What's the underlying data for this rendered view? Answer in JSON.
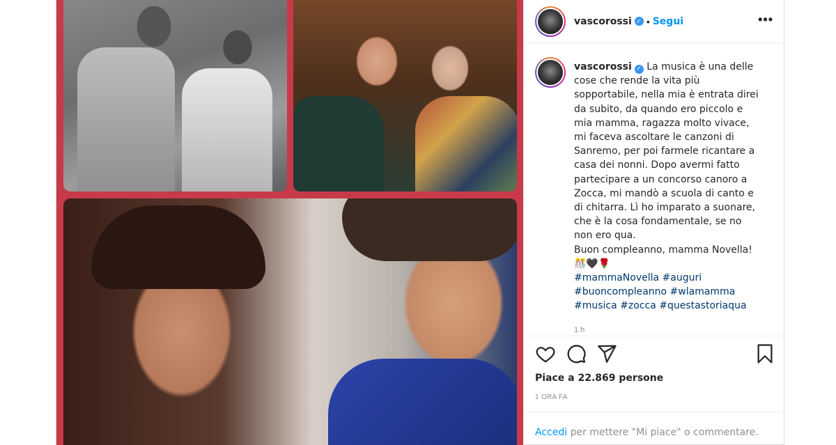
{
  "header": {
    "username": "vascorossi",
    "separator": "•",
    "follow_label": "Segui",
    "more_label": "•••"
  },
  "caption": {
    "username": "vascorossi",
    "text": "La musica è una delle cose che rende la vita più sopportabile, nella mia è entrata direi da subito, da quando ero piccolo e mia mamma, ragazza molto vivace, mi faceva ascoltare le canzoni di Sanremo, per poi farmele ricantare a casa dei nonni. Dopo avermi fatto partecipare a un concorso canoro a Zocca, mi mandò a scuola di canto e di chitarra. Lì ho imparato a suonare, che è la cosa fondamentale, se no non ero qua.\nBuon compleanno, mamma Novella!\n🎊🖤🌹",
    "hashtags": "#mammaNovella #auguri #buoncompleanno #wlamamma #musica #zocca #questastoriaqua",
    "time": "1 h"
  },
  "actions": {
    "like_icon": "heart-icon",
    "comment_icon": "comment-icon",
    "share_icon": "send-icon",
    "save_icon": "bookmark-icon"
  },
  "likes": {
    "text": "Piace a 22.869 persone"
  },
  "posted": {
    "text": "1 ORA FA"
  },
  "login": {
    "link": "Accedi",
    "text": " per mettere \"Mi piace\" o commentare."
  },
  "colors": {
    "accent": "#0095f6",
    "collage_border": "#c83a4a",
    "hashtag": "#00376b",
    "muted": "#8e8e8e"
  }
}
